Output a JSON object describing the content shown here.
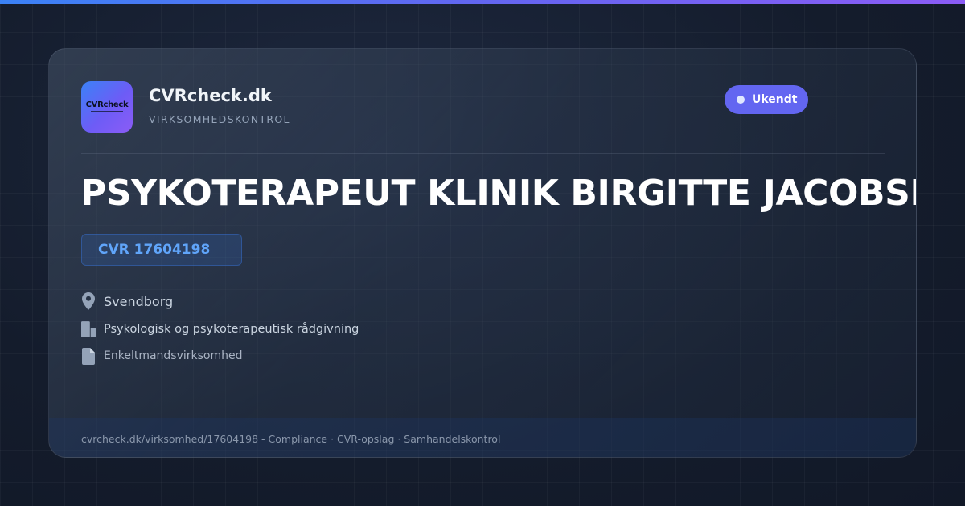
{
  "brand": {
    "logo_text": "CVRcheck",
    "name": "CVRcheck.dk",
    "tagline": "VIRKSOMHEDSKONTROL"
  },
  "status": {
    "label": "Ukendt"
  },
  "company": {
    "name": "PSYKOTERAPEUT KLINIK BIRGITTE JACOBSEN",
    "cvr": "CVR 17604198",
    "city": "Svendborg",
    "industry": "Psykologisk og psykoterapeutisk rådgivning",
    "legal_form": "Enkeltmandsvirksomhed"
  },
  "footer": {
    "text": "cvrcheck.dk/virksomhed/17604198 - Compliance · CVR-opslag · Samhandelskontrol"
  },
  "icons": {
    "city": "map-pin-icon",
    "industry": "building-icon",
    "legal_form": "document-icon"
  },
  "colors": {
    "accent_gradient_start": "#3b82f6",
    "accent_gradient_end": "#8b5cf6",
    "status_badge": "#6366f1",
    "cvr_text": "#60a5fa",
    "background": "#141c2c"
  }
}
